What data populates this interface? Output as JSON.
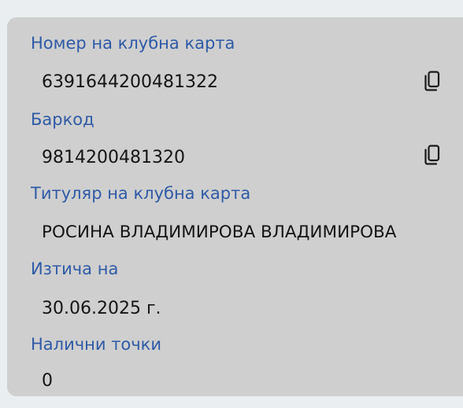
{
  "card": {
    "card_number_label": "Номер на клубна карта",
    "card_number_value": "6391644200481322",
    "barcode_label": "Баркод",
    "barcode_value": "9814200481320",
    "holder_label": "Титуляр на клубна карта",
    "holder_value": "РОСИНА ВЛАДИМИРОВА ВЛАДИМИРОВА",
    "expires_label": "Изтича на",
    "expires_value": "30.06.2025 г.",
    "points_label": "Налични точки",
    "points_value": "0"
  },
  "icons": {
    "copy": "copy-icon"
  },
  "colors": {
    "label": "#2f5aa6",
    "value": "#141414",
    "card_bg": "#cfcfcf"
  }
}
